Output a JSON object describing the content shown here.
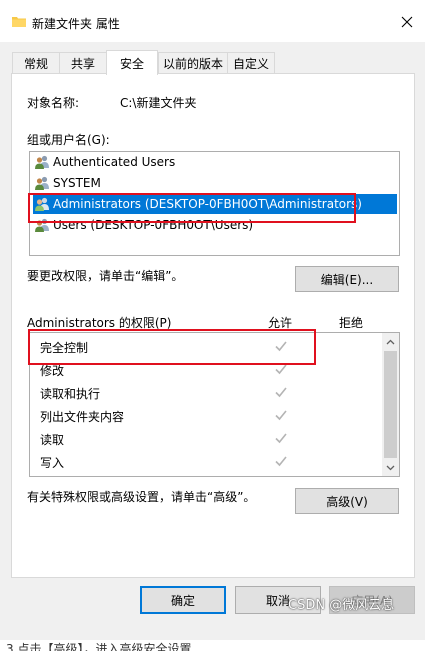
{
  "window": {
    "title": "新建文件夹 属性",
    "title_icon": "folder-icon",
    "close_icon": "close-icon"
  },
  "tabs": [
    {
      "label": "常规"
    },
    {
      "label": "共享"
    },
    {
      "label": "安全",
      "active": true
    },
    {
      "label": "以前的版本"
    },
    {
      "label": "自定义"
    }
  ],
  "security": {
    "object_name_label": "对象名称:",
    "object_name_value": "C:\\新建文件夹",
    "group_label": "组或用户名(G):",
    "groups": [
      {
        "name": "Authenticated Users",
        "icon": "users-icon"
      },
      {
        "name": "SYSTEM",
        "icon": "users-icon"
      },
      {
        "name": "Administrators (DESKTOP-0FBH0OT\\Administrators)",
        "icon": "users-icon",
        "selected": true
      },
      {
        "name": "Users (DESKTOP-0FBH0OT\\Users)",
        "icon": "users-icon"
      }
    ],
    "change_hint": "要更改权限，请单击“编辑”。",
    "edit_button": "编辑(E)...",
    "perm_header": "Administrators 的权限(P)",
    "allow_header": "允许",
    "deny_header": "拒绝",
    "permissions": [
      {
        "name": "完全控制",
        "allow": true,
        "deny": false
      },
      {
        "name": "修改",
        "allow": true,
        "deny": false
      },
      {
        "name": "读取和执行",
        "allow": true,
        "deny": false
      },
      {
        "name": "列出文件夹内容",
        "allow": true,
        "deny": false
      },
      {
        "name": "读取",
        "allow": true,
        "deny": false
      },
      {
        "name": "写入",
        "allow": true,
        "deny": false
      }
    ],
    "advanced_hint": "有关特殊权限或高级设置，请单击“高级”。",
    "advanced_button": "高级(V)"
  },
  "footer": {
    "ok_button": "确定",
    "cancel_button": "取消",
    "apply_button": "应用(A)"
  },
  "watermark": "CSDN @微风云息",
  "caption": "3.点击【高级】，进入高级安全设置"
}
